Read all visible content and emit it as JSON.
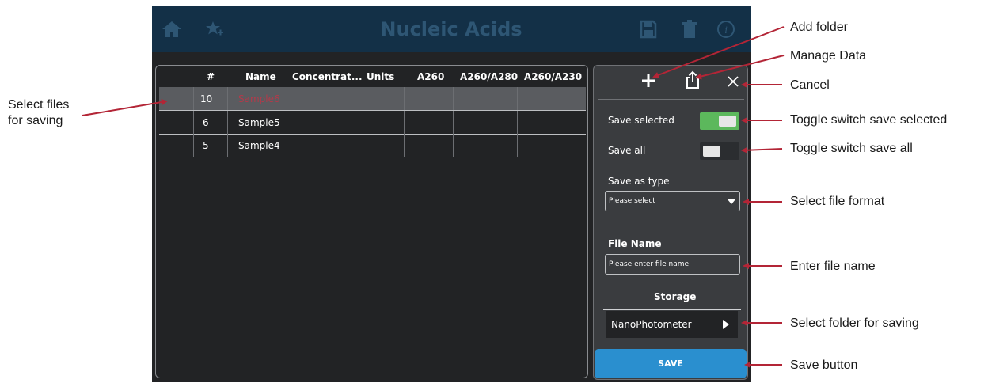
{
  "app": {
    "title": "Nucleic Acids"
  },
  "table": {
    "headers": [
      "#",
      "Name",
      "Concentrat...",
      "Units",
      "A260",
      "A260/A280",
      "A260/A230"
    ],
    "rows": [
      {
        "num": "10",
        "name": "Sample6",
        "selected": true
      },
      {
        "num": "6",
        "name": "Sample5",
        "selected": false
      },
      {
        "num": "5",
        "name": "Sample4",
        "selected": false
      }
    ]
  },
  "panel": {
    "save_selected_label": "Save selected",
    "save_selected_on": true,
    "save_all_label": "Save all",
    "save_all_on": false,
    "save_as_type_label": "Save as type",
    "save_as_type_value": "Please select",
    "file_name_label": "File Name",
    "file_name_placeholder": "Please enter file name",
    "storage_label": "Storage",
    "storage_folder": "NanoPhotometer",
    "save_button": "SAVE"
  },
  "callouts": {
    "add_folder": "Add folder",
    "manage_data": "Manage Data",
    "cancel": "Cancel",
    "toggle_selected": "Toggle switch save selected",
    "toggle_all": "Toggle switch save all",
    "file_format": "Select file format",
    "file_name": "Enter file name",
    "folder": "Select folder for saving",
    "save": "Save button",
    "select_files_line1": "Select files",
    "select_files_line2": "for saving"
  },
  "colors": {
    "topbar": "#133047",
    "accent_green": "#5cb85c",
    "save_blue": "#2a8fcf",
    "callout_arrow": "#b32536",
    "selected_row": "#5a5c60"
  },
  "icons": [
    "home-icon",
    "star-add-icon",
    "save-disk-icon",
    "trash-icon",
    "info-icon",
    "plus-icon",
    "share-export-icon",
    "close-icon",
    "dropdown-caret-icon",
    "chevron-right-icon"
  ]
}
